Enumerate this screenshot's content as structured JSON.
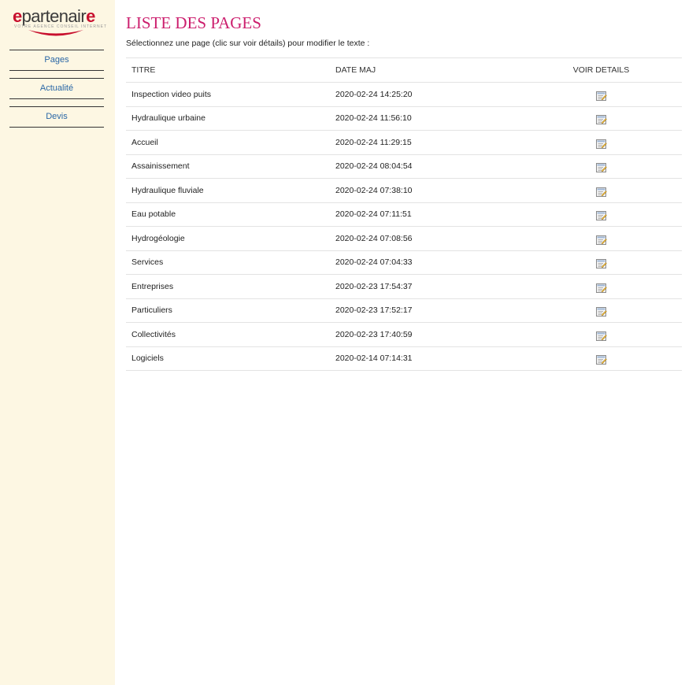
{
  "sidebar": {
    "logo": {
      "text_accent_e": "e",
      "text_main": "partenair",
      "text_accent_end": "e",
      "tagline": "VOTRE AGENCE CONSEIL INTERNET"
    },
    "nav": [
      {
        "label": "Pages"
      },
      {
        "label": "Actualité"
      },
      {
        "label": "Devis"
      }
    ]
  },
  "main": {
    "title": "LISTE DES PAGES",
    "intro": "Sélectionnez une page (clic sur voir détails) pour modifier le texte :",
    "table": {
      "headers": {
        "title": "TITRE",
        "date": "DATE MAJ",
        "action": "VOIR DETAILS"
      },
      "rows": [
        {
          "title": "Inspection video puits",
          "date": "2020-02-24 14:25:20"
        },
        {
          "title": "Hydraulique urbaine",
          "date": "2020-02-24 11:56:10"
        },
        {
          "title": "Accueil",
          "date": "2020-02-24 11:29:15"
        },
        {
          "title": "Assainissement",
          "date": "2020-02-24 08:04:54"
        },
        {
          "title": "Hydraulique fluviale",
          "date": "2020-02-24 07:38:10"
        },
        {
          "title": "Eau potable",
          "date": "2020-02-24 07:11:51"
        },
        {
          "title": "Hydrogéologie",
          "date": "2020-02-24 07:08:56"
        },
        {
          "title": "Services",
          "date": "2020-02-24 07:04:33"
        },
        {
          "title": "Entreprises",
          "date": "2020-02-23 17:54:37"
        },
        {
          "title": "Particuliers",
          "date": "2020-02-23 17:52:17"
        },
        {
          "title": "Collectivités",
          "date": "2020-02-23 17:40:59"
        },
        {
          "title": "Logiciels",
          "date": "2020-02-14 07:14:31"
        }
      ]
    }
  },
  "colors": {
    "sidebar_bg": "#fdf7e3",
    "title": "#cc1f6e",
    "nav_link": "#2a67a6",
    "logo_accent": "#c8102e"
  },
  "icons": {
    "edit": "edit-details-icon"
  }
}
